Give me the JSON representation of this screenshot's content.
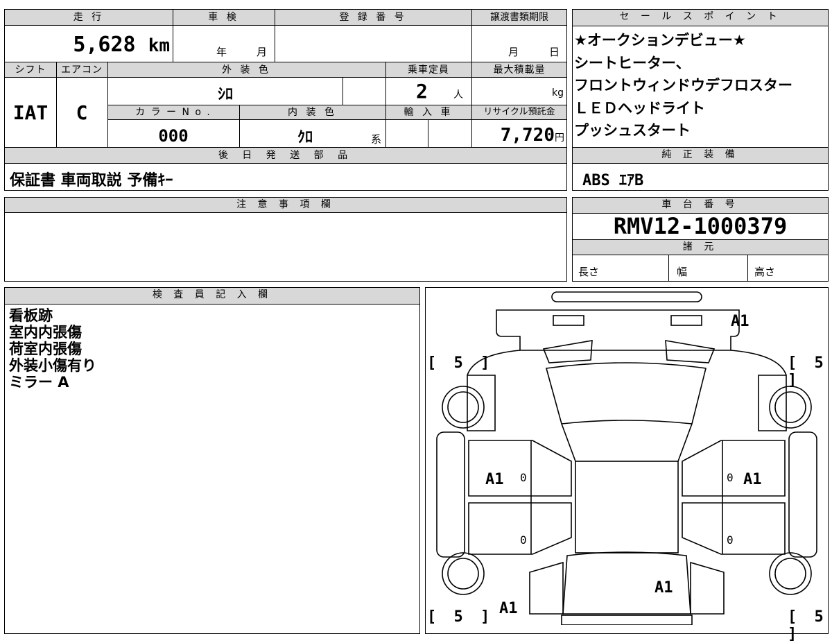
{
  "main_table": {
    "headers": {
      "mileage": "走 行",
      "inspection": "車 検",
      "registration": "登 録 番 号",
      "transfer_deadline": "譲渡書類期限",
      "shift": "シフト",
      "aircon": "エアコン",
      "exterior_color": "外 装 色",
      "capacity": "乗車定員",
      "max_load": "最大積載量",
      "color_no": "カ ラ ー N o .",
      "interior_color": "内 装 色",
      "import": "輸 入 車",
      "recycle": "リサイクル預託金"
    },
    "mileage_value": "5,628",
    "mileage_unit": "km",
    "inspection_year": "年",
    "inspection_month": "月",
    "transfer_month": "月",
    "transfer_day": "日",
    "shift_value": "IAT",
    "aircon_value": "C",
    "exterior_color_value": "ｼﾛ",
    "capacity_value": "2",
    "capacity_unit": "人",
    "max_load_unit": "kg",
    "color_no_value": "000",
    "interior_color_value": "ｸﾛ",
    "interior_color_suffix": "系",
    "recycle_value": "7,720",
    "recycle_unit": "円"
  },
  "later_shipping": {
    "header": "後 日 発 送 部 品",
    "value": "保証書 車両取説 予備ｷｰ"
  },
  "notes_section": {
    "header": "注 意 事 項 欄",
    "value": ""
  },
  "inspector_section": {
    "header": "検 査 員 記 入 欄",
    "lines": [
      "看板跡",
      "室内内張傷",
      "荷室内張傷",
      "外装小傷有り",
      "ミラー A"
    ]
  },
  "sales_points": {
    "header": "セ ー ル ス ポ イ ン ト",
    "lines": [
      "★オークションデビュー★",
      "シートヒーター、",
      "フロントウィンドウデフロスター",
      "ＬＥＤヘッドライト",
      "プッシュスタート"
    ]
  },
  "standard_equipment": {
    "header": "純 正 装 備",
    "value": "ABS ｴｱB"
  },
  "chassis": {
    "header": "車 台 番 号",
    "value": "RMV12-1000379",
    "specs_header": "諸 元",
    "length_label": "長さ",
    "width_label": "幅",
    "height_label": "高さ"
  },
  "diagram": {
    "marks": {
      "front_right": "A1",
      "left_door": "A1",
      "right_door": "A1",
      "rear_center": "A1",
      "rear_left": "A1"
    },
    "brackets": {
      "top_left": "[ 5 ]",
      "top_right": "[ 5 ]",
      "bottom_left": "[ 5 ]",
      "bottom_right": "[ 5 ]"
    },
    "zeros": {
      "left_upper": "0",
      "left_lower": "0",
      "right_upper": "0",
      "right_lower": "0"
    }
  }
}
